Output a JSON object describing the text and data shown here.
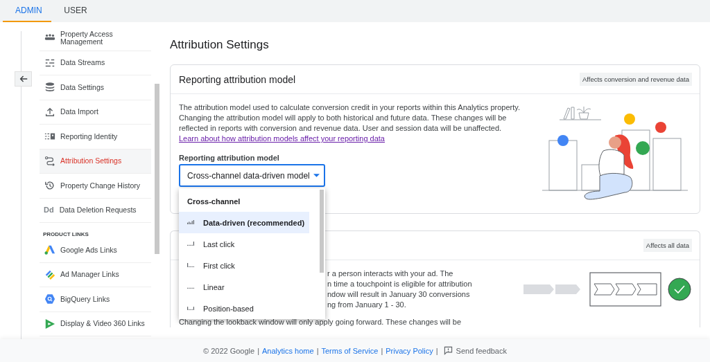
{
  "tabs": [
    {
      "label": "ADMIN",
      "selected": true
    },
    {
      "label": "USER",
      "selected": false
    }
  ],
  "sidebar": {
    "sections": [
      {
        "items": [
          {
            "label": "Property Access Management",
            "selected": false
          },
          {
            "label": "Data Streams",
            "selected": false
          },
          {
            "label": "Data Settings",
            "selected": false
          },
          {
            "label": "Data Import",
            "selected": false
          },
          {
            "label": "Reporting Identity",
            "selected": false
          },
          {
            "label": "Attribution Settings",
            "selected": true
          },
          {
            "label": "Property Change History",
            "selected": false
          },
          {
            "label": "Data Deletion Requests",
            "selected": false,
            "icon_text": "Dd"
          }
        ]
      },
      {
        "heading": "PRODUCT LINKS",
        "items": [
          {
            "label": "Google Ads Links",
            "selected": false
          },
          {
            "label": "Ad Manager Links",
            "selected": false
          },
          {
            "label": "BigQuery Links",
            "selected": false
          },
          {
            "label": "Display & Video 360 Links",
            "selected": false
          }
        ]
      }
    ]
  },
  "page_title": "Attribution Settings",
  "reporting_card": {
    "title": "Reporting attribution model",
    "badge": "Affects conversion and revenue data",
    "description": "The attribution model used to calculate conversion credit in your reports within this Analytics property. Changing the attribution model will apply to both historical and future data. These changes will be reflected in reports with conversion and revenue data. User and session data will be unaffected.",
    "link": "Learn about how attribution models affect your reporting data",
    "field": {
      "label": "Reporting attribution model",
      "value": "Cross-channel data-driven model",
      "expanded": true,
      "menu": [
        {
          "kind": "header",
          "label": "Cross-channel"
        },
        {
          "kind": "option",
          "label": "Data-driven (recommended)",
          "selected": true
        },
        {
          "kind": "option",
          "label": "Last click",
          "selected": false
        },
        {
          "kind": "option",
          "label": "First click",
          "selected": false
        },
        {
          "kind": "option",
          "label": "Linear",
          "selected": false
        },
        {
          "kind": "option",
          "label": "Position-based",
          "selected": false
        }
      ]
    }
  },
  "lookback_card": {
    "badge": "Affects all data",
    "fragments": [
      "r a person interacts with your ad. The",
      "n time a touchpoint is eligible for attribution",
      "ndow will result in January 30 conversions",
      "ng from January 1 - 30."
    ],
    "note": "Changing the lookback window will only apply going forward. These changes will be"
  },
  "footer": {
    "items": [
      {
        "kind": "text",
        "label": "© 2022 Google"
      },
      {
        "kind": "separator",
        "label": "|"
      },
      {
        "kind": "link",
        "label": "Analytics home"
      },
      {
        "kind": "separator",
        "label": "|"
      },
      {
        "kind": "link",
        "label": "Terms of Service"
      },
      {
        "kind": "separator",
        "label": "|"
      },
      {
        "kind": "link",
        "label": "Privacy Policy"
      },
      {
        "kind": "separator",
        "label": "|"
      },
      {
        "kind": "feedback",
        "label": "Send feedback"
      }
    ]
  }
}
